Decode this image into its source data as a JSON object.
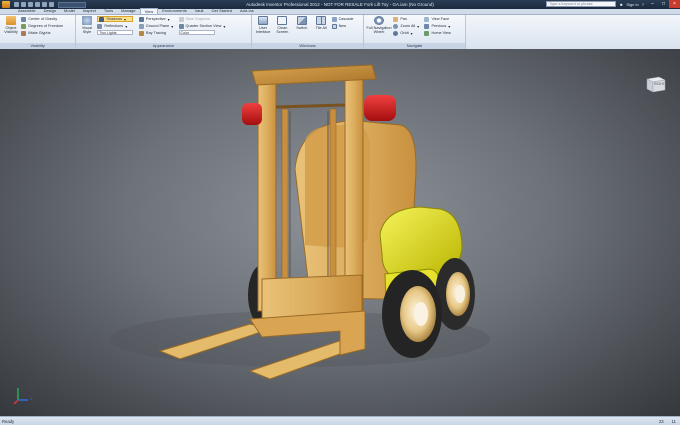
{
  "window": {
    "title": "Autodesk Inventor Professional 2012 - NOT FOR RESALE   Fork Lift Toy - GA.iam (No Ground)",
    "search_placeholder": "Type a keyword or phrase",
    "sign_in": "Sign In"
  },
  "tabs": [
    "Assemble",
    "Design",
    "Model",
    "Inspect",
    "Tools",
    "Manage",
    "View",
    "Environments",
    "Vault",
    "Get Started",
    "Add-Ins"
  ],
  "active_tab": "View",
  "ribbon": {
    "visibility": {
      "object_visibility": "Object Visibility",
      "center_of_gravity": "Center of Gravity",
      "degrees_of_freedom": "Degrees of Freedom",
      "weld_glyphs": "iMate Glyphs",
      "caption": "Visibility"
    },
    "appearance": {
      "visual_style": "Visual Style",
      "shadows": "Shadows",
      "reflections": "Reflections",
      "lighting": "Two Lights",
      "perspective": "Perspective",
      "ground_plane": "Ground Plane",
      "ray_tracing": "Ray Tracing",
      "slice_graphics": "Slice Graphics",
      "quarter_section": "Quarter Section View",
      "color": "Color",
      "caption": "Appearance"
    },
    "windows": {
      "user_interface": "User Interface",
      "clean_screen": "Clean Screen",
      "switch": "Switch",
      "tile_all": "Tile All",
      "cascade": "Cascade",
      "new": "New",
      "caption": "Windows"
    },
    "navigate": {
      "full_nav_wheel": "Full Navigation Wheel",
      "pan": "Pan",
      "zoom_all": "Zoom All",
      "orbit": "Orbit",
      "view_face": "View Face",
      "previous": "Previous",
      "home_view": "Home View",
      "caption": "Navigate"
    }
  },
  "viewport": {
    "model_name": "Fork Lift Toy",
    "viewcube_label": "RIGHT",
    "axis_label": "Z"
  },
  "status": {
    "left": "Ready",
    "right_count_1": "23",
    "right_count_2": "11"
  }
}
